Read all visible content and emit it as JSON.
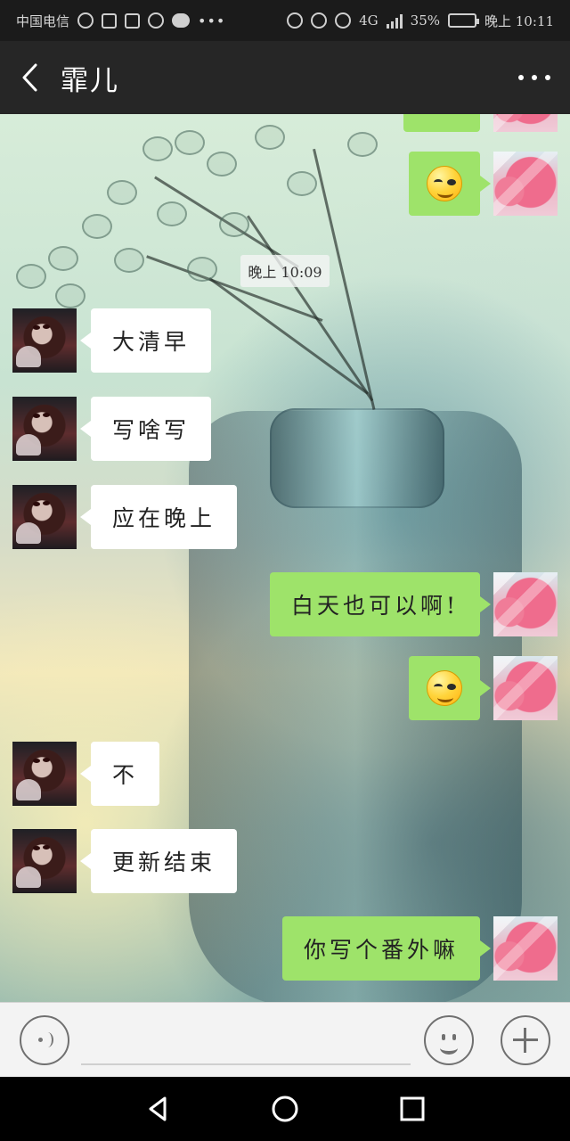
{
  "status_bar": {
    "carrier": "中国电信",
    "network": "4G",
    "battery": "35%",
    "time": "晚上 10:11"
  },
  "header": {
    "title": "霏儿"
  },
  "chat": {
    "time_separator": "晚上 10:09",
    "messages": [
      {
        "side": "right",
        "type": "emoji",
        "text": "",
        "icon": "smile-emoji-icon"
      },
      {
        "side": "left",
        "type": "text",
        "text": "大清早"
      },
      {
        "side": "left",
        "type": "text",
        "text": "写啥写"
      },
      {
        "side": "left",
        "type": "text",
        "text": "应在晚上"
      },
      {
        "side": "right",
        "type": "text",
        "text": "白天也可以啊!"
      },
      {
        "side": "right",
        "type": "emoji",
        "text": "",
        "icon": "smile-emoji-icon"
      },
      {
        "side": "left",
        "type": "text",
        "text": "不"
      },
      {
        "side": "left",
        "type": "text",
        "text": "更新结束"
      },
      {
        "side": "right",
        "type": "text",
        "text": "你写个番外嘛"
      }
    ]
  },
  "input_bar": {
    "voice_icon": "voice-icon",
    "emoji_icon": "emoji-icon",
    "plus_icon": "plus-icon"
  },
  "system_nav": {
    "back_icon": "back-triangle-icon",
    "home_icon": "home-circle-icon",
    "recent_icon": "recent-square-icon"
  },
  "colors": {
    "header_bg": "#262626",
    "status_bg": "#1b1b1b",
    "outgoing_bubble": "#9ee36a",
    "incoming_bubble": "#ffffff",
    "input_bg": "#f3f3f3"
  }
}
